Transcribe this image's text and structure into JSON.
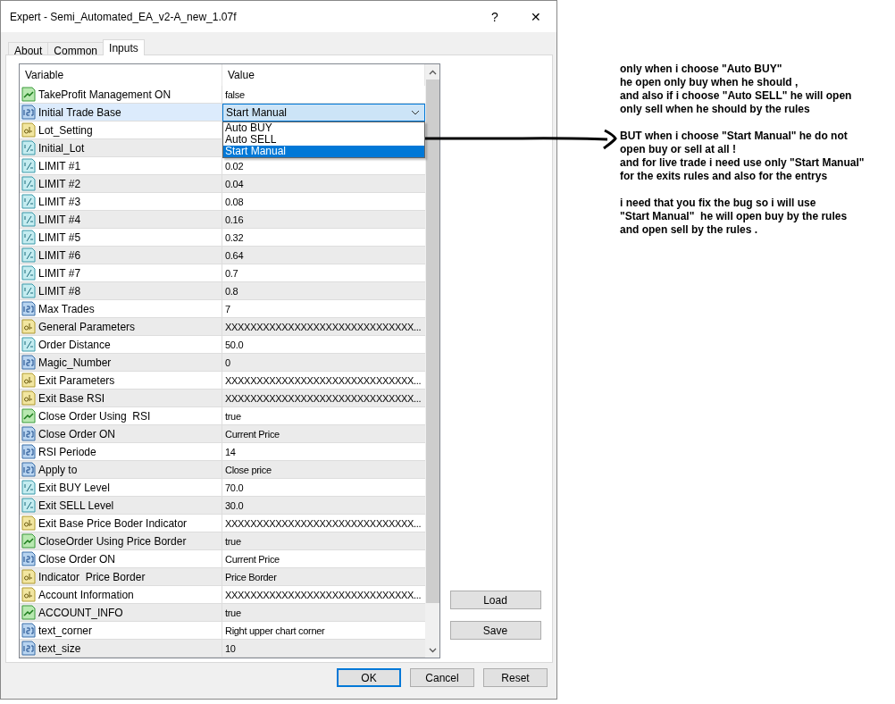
{
  "window": {
    "title": "Expert - Semi_Automated_EA_v2-A_new_1.07f",
    "help": "?",
    "close": "✕"
  },
  "tabs": [
    {
      "label": "About",
      "selected": false
    },
    {
      "label": "Common",
      "selected": false
    },
    {
      "label": "Inputs",
      "selected": true
    }
  ],
  "table": {
    "columns": [
      "Variable",
      "Value"
    ],
    "rows": [
      {
        "kind": "bool",
        "variable": "TakeProfit Management ON",
        "value": "false",
        "selected": false
      },
      {
        "kind": "int",
        "variable": "Initial Trade Base",
        "value": "Start Manual",
        "selected": true,
        "dropdown": {
          "options": [
            {
              "label": "Auto BUY",
              "selected": false
            },
            {
              "label": "Auto SELL",
              "selected": false
            },
            {
              "label": "Start Manual",
              "selected": true
            }
          ]
        }
      },
      {
        "kind": "string",
        "variable": "Lot_Setting",
        "selected": false
      },
      {
        "kind": "double",
        "variable": "Initial_Lot",
        "selected": false
      },
      {
        "kind": "double",
        "variable": "LIMIT #1",
        "value": "0.02",
        "selected": false
      },
      {
        "kind": "double",
        "variable": "LIMIT #2",
        "value": "0.04",
        "selected": false
      },
      {
        "kind": "double",
        "variable": "LIMIT #3",
        "value": "0.08",
        "selected": false
      },
      {
        "kind": "double",
        "variable": "LIMIT #4",
        "value": "0.16",
        "selected": false
      },
      {
        "kind": "double",
        "variable": "LIMIT #5",
        "value": "0.32",
        "selected": false
      },
      {
        "kind": "double",
        "variable": "LIMIT #6",
        "value": "0.64",
        "selected": false
      },
      {
        "kind": "double",
        "variable": "LIMIT #7",
        "value": "0.7",
        "selected": false
      },
      {
        "kind": "double",
        "variable": "LIMIT #8",
        "value": "0.8",
        "selected": false
      },
      {
        "kind": "int",
        "variable": "Max Trades",
        "value": "7",
        "selected": false
      },
      {
        "kind": "string",
        "variable": "General Parameters",
        "value": "XXXXXXXXXXXXXXXXXXXXXXXXXXXXXX...",
        "selected": false
      },
      {
        "kind": "double",
        "variable": "Order Distance",
        "value": "50.0",
        "selected": false
      },
      {
        "kind": "int",
        "variable": "Magic_Number",
        "value": "0",
        "selected": false
      },
      {
        "kind": "string",
        "variable": "Exit Parameters",
        "value": "XXXXXXXXXXXXXXXXXXXXXXXXXXXXXX...",
        "selected": false
      },
      {
        "kind": "string",
        "variable": "Exit Base RSI",
        "value": "XXXXXXXXXXXXXXXXXXXXXXXXXXXXXX...",
        "selected": false
      },
      {
        "kind": "bool",
        "variable": "Close Order Using  RSI",
        "value": "true",
        "selected": false
      },
      {
        "kind": "int",
        "variable": "Close Order ON",
        "value": "Current Price",
        "selected": false
      },
      {
        "kind": "int",
        "variable": "RSI Periode",
        "value": "14",
        "selected": false
      },
      {
        "kind": "int",
        "variable": "Apply to",
        "value": "Close price",
        "selected": false
      },
      {
        "kind": "double",
        "variable": "Exit BUY Level",
        "value": "70.0",
        "selected": false
      },
      {
        "kind": "double",
        "variable": "Exit SELL Level",
        "value": "30.0",
        "selected": false
      },
      {
        "kind": "string",
        "variable": "Exit Base Price Boder Indicator",
        "value": "XXXXXXXXXXXXXXXXXXXXXXXXXXXXXX...",
        "selected": false
      },
      {
        "kind": "bool",
        "variable": "CloseOrder Using Price Border",
        "value": "true",
        "selected": false
      },
      {
        "kind": "int",
        "variable": "Close Order ON",
        "value": "Current Price",
        "selected": false
      },
      {
        "kind": "string",
        "variable": "Indicator  Price Border",
        "value": "Price Border",
        "selected": false
      },
      {
        "kind": "string",
        "variable": "Account Information",
        "value": "XXXXXXXXXXXXXXXXXXXXXXXXXXXXXX...",
        "selected": false
      },
      {
        "kind": "bool",
        "variable": "ACCOUNT_INFO",
        "value": "true",
        "selected": false
      },
      {
        "kind": "int",
        "variable": "text_corner",
        "value": "Right upper chart corner",
        "selected": false
      },
      {
        "kind": "int",
        "variable": "text_size",
        "value": "10",
        "selected": false
      }
    ]
  },
  "side_buttons": [
    "Load",
    "Save"
  ],
  "buttons": [
    {
      "label": "OK",
      "default": true
    },
    {
      "label": "Cancel",
      "default": false
    },
    {
      "label": "Reset",
      "default": false
    }
  ],
  "annotation": {
    "paragraphs": [
      [
        "only when i choose \"Auto BUY\"",
        "he open only buy when he should ,",
        "and also if i choose \"Auto SELL\" he will open",
        "only sell when he should by the rules"
      ],
      [
        "BUT when i choose \"Start Manual\" he do not",
        "open buy or sell at all !",
        "and for live trade i need use only \"Start Manual\"",
        "for the exits rules and also for the entrys"
      ],
      [
        "i need that you fix the bug so i will use",
        "\"Start Manual\"  he will open buy by the rules",
        "and open sell by the rules ."
      ]
    ]
  }
}
